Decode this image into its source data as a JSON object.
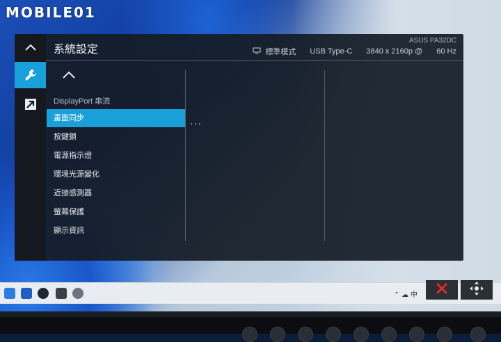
{
  "watermark": "MOBILE01",
  "osd": {
    "title": "系統設定",
    "status": {
      "model": "ASUS PA32DC",
      "mode": "標準模式",
      "input": "USB Type-C",
      "resolution": "3840 x 2160p @",
      "refresh": "60 Hz"
    },
    "rail": [
      {
        "name": "up",
        "icon": "chevron-up-icon"
      },
      {
        "name": "system-setup",
        "icon": "wrench-icon",
        "active": true
      },
      {
        "name": "shortcut",
        "icon": "arrow-diagonal-icon"
      }
    ],
    "section_label": "DisplayPort 串流",
    "items": [
      {
        "label": "畫面同步",
        "selected": true
      },
      {
        "label": "按鍵鎖"
      },
      {
        "label": "電源指示燈"
      },
      {
        "label": "環境光源變化"
      },
      {
        "label": "近接感測器"
      },
      {
        "label": "螢幕保護"
      },
      {
        "label": "顯示資訊"
      }
    ],
    "submenu_indicator": "..."
  },
  "taskbar": {
    "tray_text": "中",
    "buttons": [
      "close-icon",
      "navigate-icon"
    ]
  },
  "colors": {
    "accent": "#1aa0d8",
    "osd_bg": "#141c26",
    "close_red": "#e02b2b"
  }
}
